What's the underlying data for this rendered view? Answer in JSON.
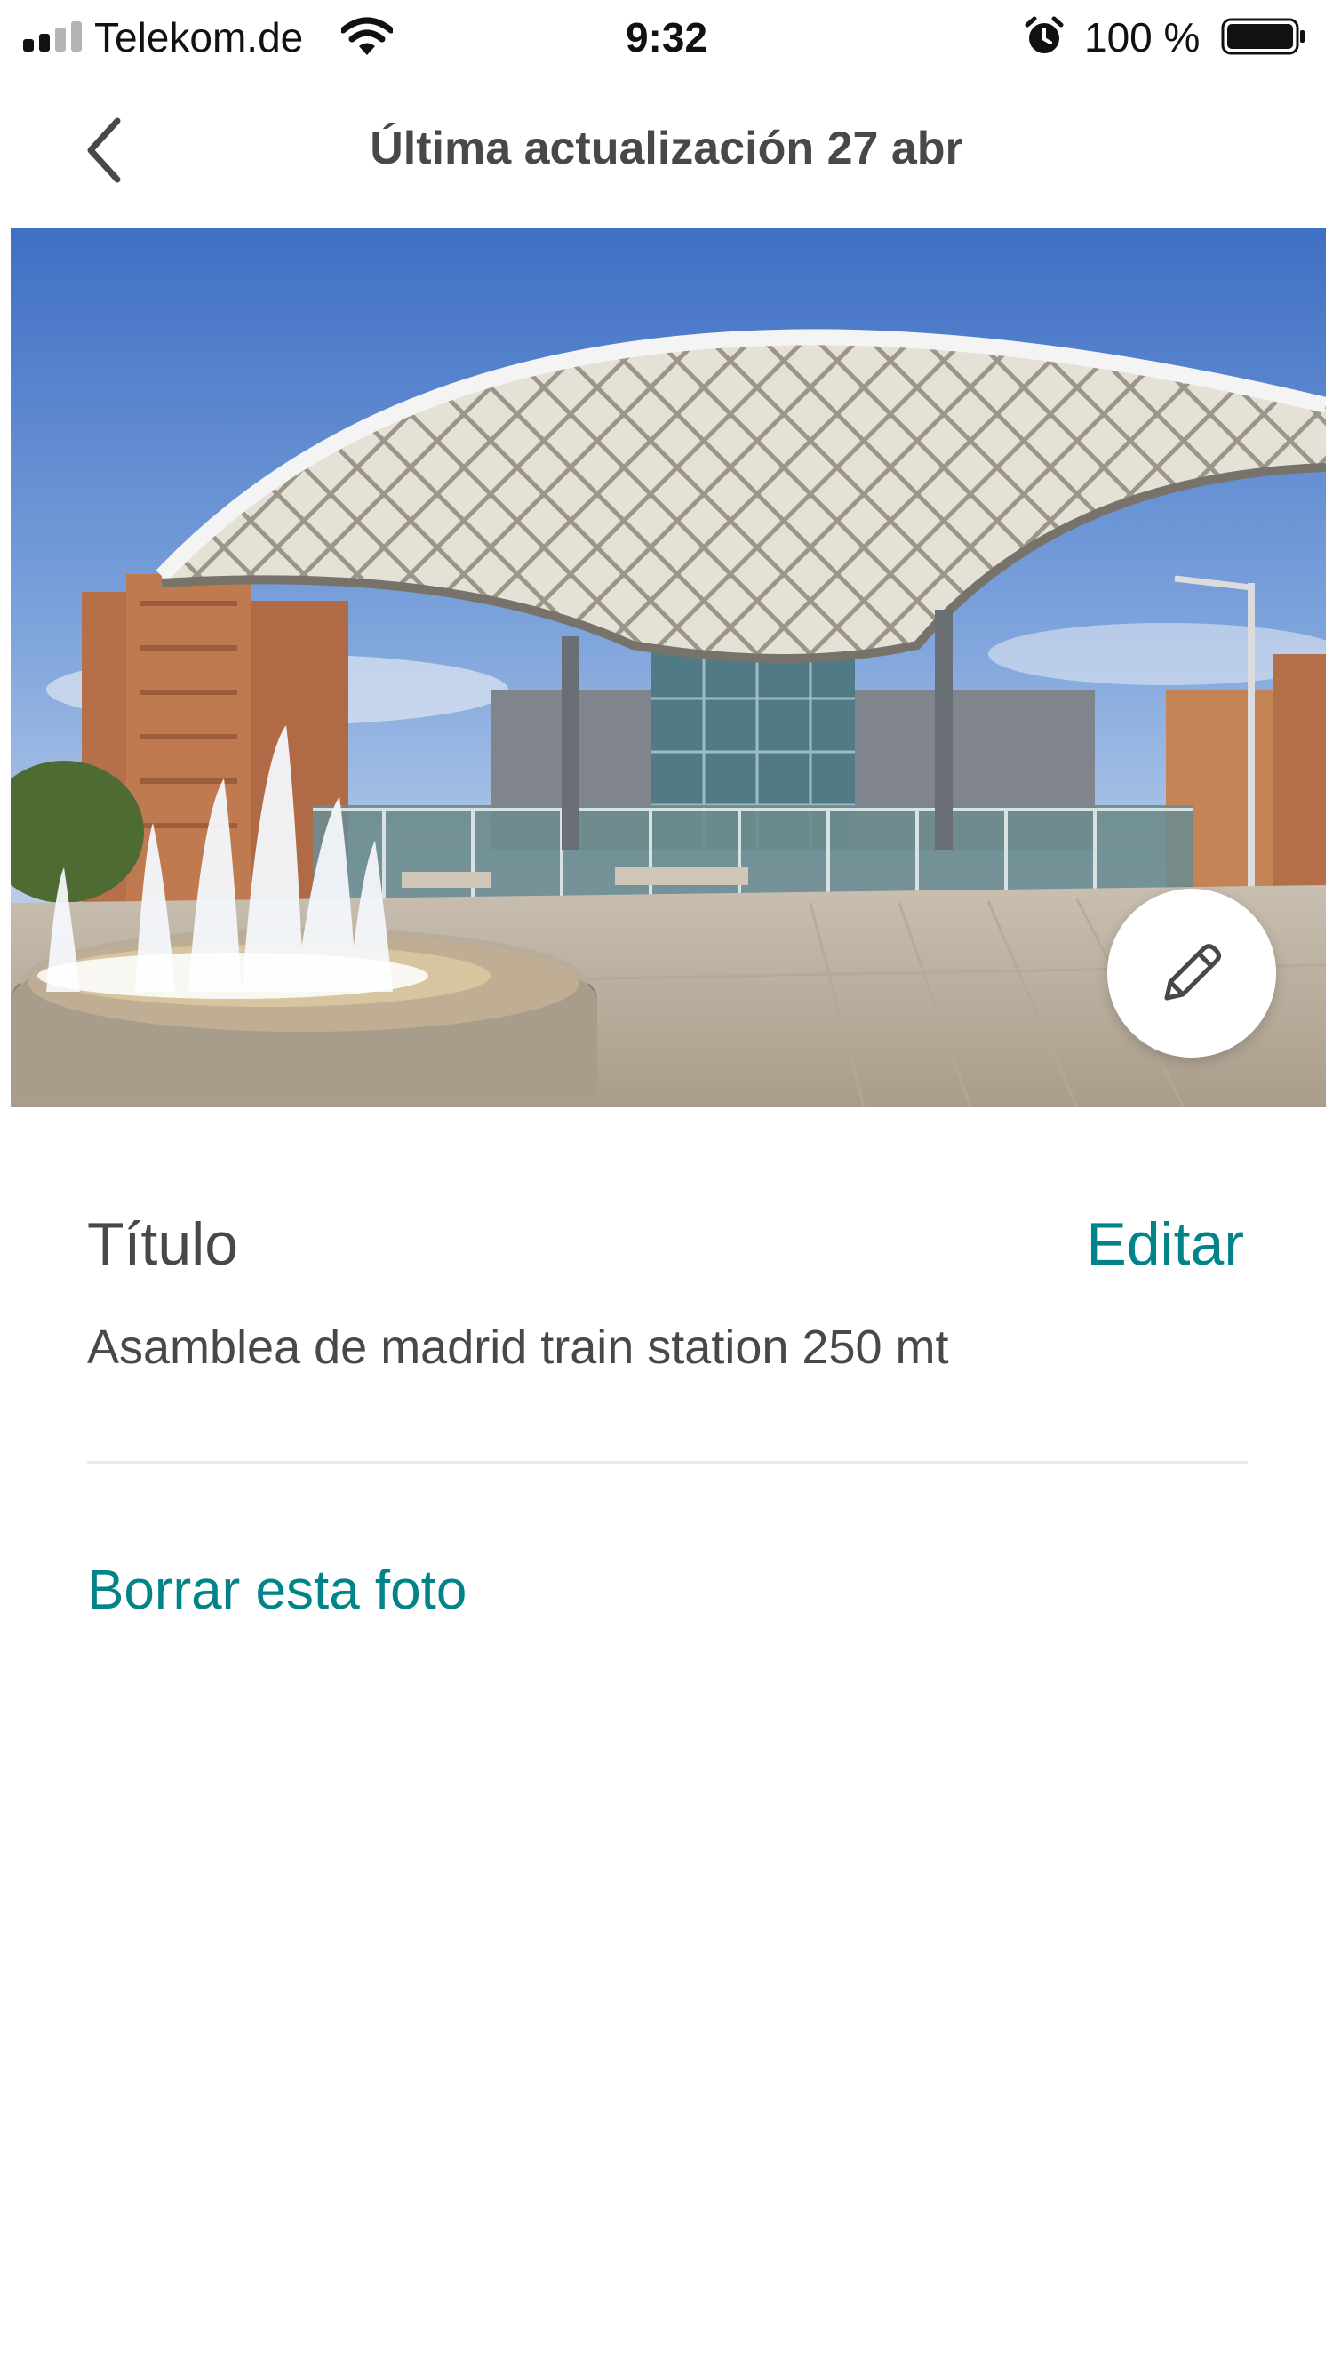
{
  "status_bar": {
    "carrier": "Telekom.de",
    "time": "9:32",
    "battery": "100 %",
    "icons": [
      "signal-icon",
      "wifi-icon",
      "alarm-icon",
      "battery-icon"
    ]
  },
  "nav": {
    "title": "Última actualización 27 abr",
    "back_icon": "chevron-left-icon"
  },
  "photo": {
    "edit_icon": "pencil-icon"
  },
  "details": {
    "title_label": "Título",
    "edit_label": "Editar",
    "title_value": "Asamblea de madrid train station 250 mt",
    "delete_label": "Borrar esta foto"
  },
  "colors": {
    "accent": "#008489",
    "text": "#484848",
    "divider": "#ebebeb"
  }
}
